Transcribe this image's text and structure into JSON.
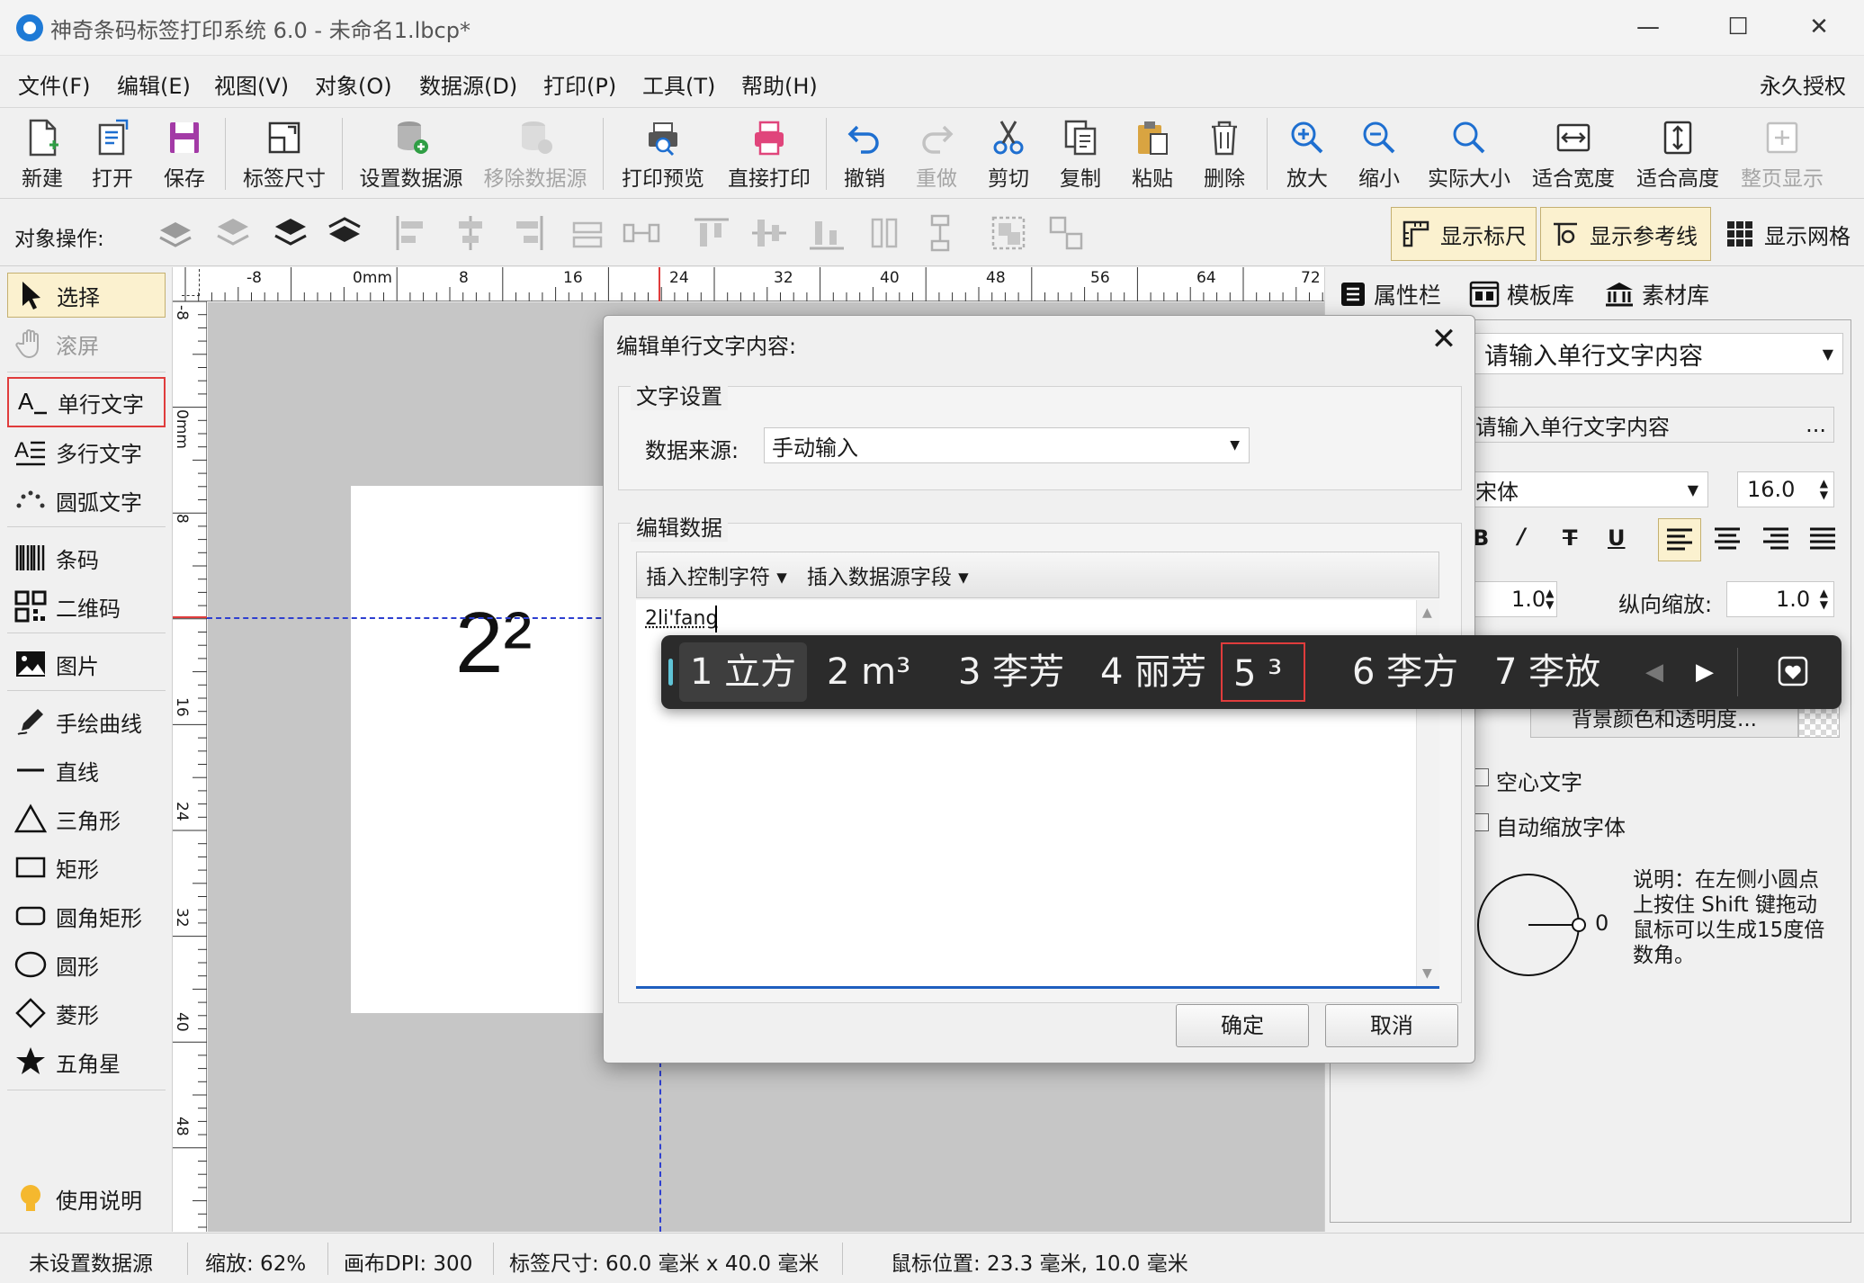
{
  "window": {
    "title": "神奇条码标签打印系统 6.0 - 未命名1.lbcp*",
    "minimize": "—",
    "maximize": "☐",
    "close": "✕"
  },
  "menu": {
    "items": [
      "文件(F)",
      "编辑(E)",
      "视图(V)",
      "对象(O)",
      "数据源(D)",
      "打印(P)",
      "工具(T)",
      "帮助(H)"
    ],
    "license": "永久授权"
  },
  "toolbar": {
    "new": "新建",
    "open": "打开",
    "save": "保存",
    "label_size": "标签尺寸",
    "set_datasource": "设置数据源",
    "remove_datasource": "移除数据源",
    "print_preview": "打印预览",
    "direct_print": "直接打印",
    "undo": "撤销",
    "redo": "重做",
    "cut": "剪切",
    "copy": "复制",
    "paste": "粘贴",
    "delete": "删除",
    "zoom_in": "放大",
    "zoom_out": "缩小",
    "actual_size": "实际大小",
    "fit_width": "适合宽度",
    "fit_height": "适合高度",
    "fit_page": "整页显示"
  },
  "objbar": {
    "label": "对象操作:",
    "show_ruler": "显示标尺",
    "show_guides": "显示参考线",
    "show_grid": "显示网格"
  },
  "tools": {
    "select": "选择",
    "scroll": "滚屏",
    "single_text": "单行文字",
    "multi_text": "多行文字",
    "arc_text": "圆弧文字",
    "barcode": "条码",
    "qrcode": "二维码",
    "image": "图片",
    "freehand": "手绘曲线",
    "line": "直线",
    "triangle": "三角形",
    "rectangle": "矩形",
    "rounded_rect": "圆角矩形",
    "circle": "圆形",
    "diamond": "菱形",
    "star": "五角星",
    "help": "使用说明"
  },
  "ruler": {
    "h_ticks": [
      "-8",
      "0mm",
      "8",
      "16",
      "24",
      "32",
      "40",
      "48",
      "56",
      "64",
      "72"
    ],
    "v_ticks": [
      "-8",
      "0mm",
      "8",
      "16",
      "24",
      "32",
      "40",
      "48"
    ]
  },
  "canvas": {
    "label_text": "2²"
  },
  "rightpanel": {
    "tabs": [
      "属性栏",
      "模板库",
      "素材库"
    ],
    "content_select": "请输入单行文字内容",
    "content_field": "请输入单行文字内容",
    "content_field_btn": "...",
    "font": "宋体",
    "font_size": "16.0",
    "h_scale": "1.0",
    "v_scale_label": "纵向缩放:",
    "v_scale": "1.0",
    "bg_color_btn": "背景颜色和透明度...",
    "hollow": "空心文字",
    "auto_shrink": "自动缩放字体",
    "angle": "0",
    "note": "说明：在左侧小圆点上按住 Shift 键拖动鼠标可以生成15度倍数角。"
  },
  "dialog": {
    "title": "编辑单行文字内容:",
    "close": "✕",
    "group_text": "文字设置",
    "source_label": "数据来源:",
    "source_value": "手动输入",
    "group_edit": "编辑数据",
    "insert_ctrl": "插入控制字符",
    "insert_field": "插入数据源字段",
    "editor_text": "2li'fang",
    "ok": "确定",
    "cancel": "取消"
  },
  "ime": {
    "candidates": [
      "1 立方",
      "2 m³",
      "3 李芳",
      "4 丽芳",
      "5 ³",
      "6 李方",
      "7 李放"
    ]
  },
  "status": {
    "datasource": "未设置数据源",
    "zoom": "缩放: 62%",
    "dpi": "画布DPI: 300",
    "label_size": "标签尺寸: 60.0 毫米 x 40.0 毫米",
    "mouse_pos": "鼠标位置: 23.3 毫米, 10.0 毫米"
  }
}
